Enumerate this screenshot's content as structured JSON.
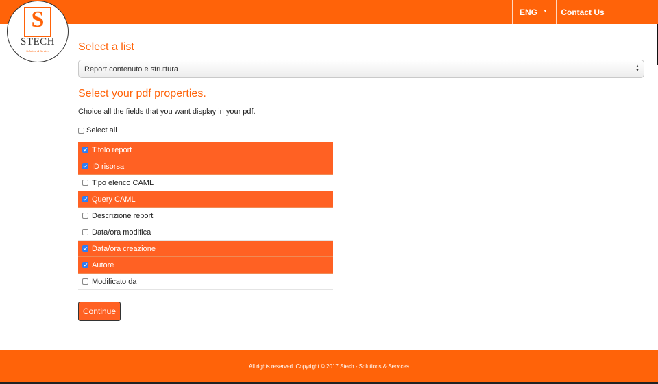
{
  "colors": {
    "brand_orange": "#ff6309",
    "row_highlight": "#ff6123",
    "checkbox_checked": "#2d7df5",
    "button_bg": "#ff6123"
  },
  "logo": {
    "letter": "S",
    "name": "STECH",
    "tagline": "Solutions & Services"
  },
  "header": {
    "language_label": "ENG",
    "language_icon": "chevron-down-icon",
    "contact_label": "Contact Us"
  },
  "list_section": {
    "title": "Select a list",
    "selected_value": "Report contenuto e struttura"
  },
  "pdf_section": {
    "title": "Select your pdf properties.",
    "subtitle": "Choice all the fields that you want display in your pdf.",
    "select_all_label": "Select all",
    "select_all_checked": false,
    "fields": [
      {
        "label": "Titolo report",
        "checked": true
      },
      {
        "label": "ID risorsa",
        "checked": true
      },
      {
        "label": "Tipo elenco CAML",
        "checked": false
      },
      {
        "label": "Query CAML",
        "checked": true
      },
      {
        "label": "Descrizione report",
        "checked": false
      },
      {
        "label": "Data/ora modifica",
        "checked": false
      },
      {
        "label": "Data/ora creazione",
        "checked": true
      },
      {
        "label": "Autore",
        "checked": true
      },
      {
        "label": "Modificato da",
        "checked": false
      }
    ]
  },
  "continue_label": "Continue",
  "footer": {
    "text": "All rights reserved. Copyright © 2017 Stech - Solutions & Services"
  }
}
